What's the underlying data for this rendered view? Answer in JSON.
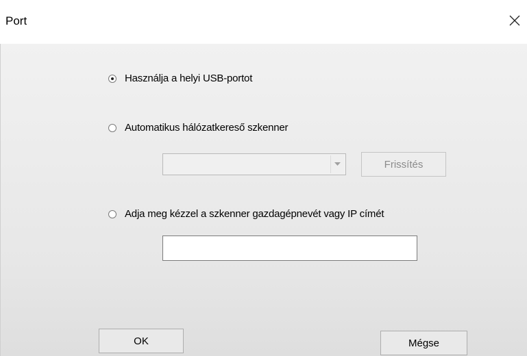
{
  "window": {
    "title": "Port",
    "close_icon": "close-icon"
  },
  "options": {
    "usb_label": "Használja a helyi USB-portot",
    "usb_selected": true,
    "network_label": "Automatikus hálózatkereső szkenner",
    "network_selected": false,
    "manual_label": "Adja meg kézzel a szkenner gazdagépnevét vagy IP címét",
    "manual_selected": false
  },
  "network": {
    "scanner_select_value": "",
    "refresh_label": "Frissítés"
  },
  "manual": {
    "host_input_value": ""
  },
  "footer": {
    "ok_label": "OK",
    "cancel_label": "Mégse"
  }
}
